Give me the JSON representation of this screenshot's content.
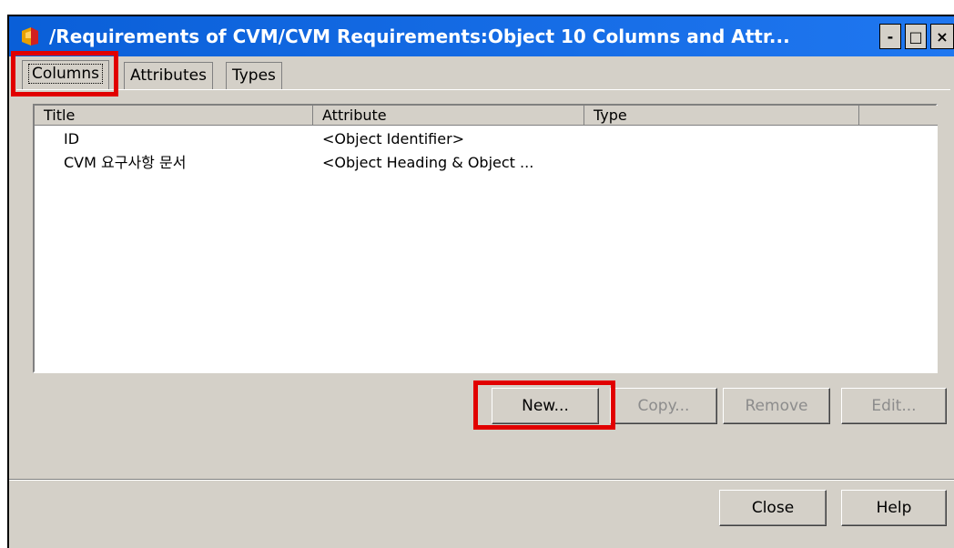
{
  "window": {
    "title": "/Requirements of CVM/CVM Requirements:Object 10 Columns and Attr...",
    "minimize_label": "-",
    "maximize_label": "□",
    "close_label": "×"
  },
  "tabs": [
    {
      "label": "Columns",
      "selected": true
    },
    {
      "label": "Attributes",
      "selected": false
    },
    {
      "label": "Types",
      "selected": false
    }
  ],
  "list": {
    "headers": [
      "Title",
      "Attribute",
      "Type"
    ],
    "rows": [
      {
        "title": "ID",
        "attribute": "<Object Identifier>",
        "type": ""
      },
      {
        "title": "CVM 요구사항 문서",
        "attribute": "<Object Heading & Object ...",
        "type": ""
      }
    ]
  },
  "buttons": {
    "new": "New...",
    "copy": "Copy...",
    "remove": "Remove",
    "edit": "Edit...",
    "close": "Close",
    "help": "Help"
  },
  "highlight_color": "#e10000"
}
